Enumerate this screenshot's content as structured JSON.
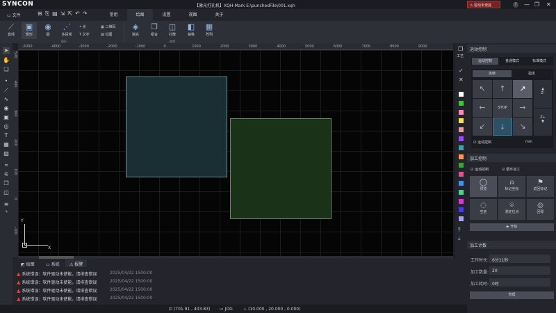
{
  "app": {
    "logo": "SYNCON",
    "title": "【激光打孔机】XQH-Mark  E:\\punchedFile\\001.xqh",
    "alarm": "驱动未使能",
    "help": "?",
    "minimize": "—",
    "restore": "❐",
    "close": "✕"
  },
  "menu": {
    "file": "文件",
    "tabs": [
      {
        "label": "常用"
      },
      {
        "label": "绘图"
      },
      {
        "label": "设置"
      },
      {
        "label": "视图"
      },
      {
        "label": "关于"
      }
    ],
    "active": "绘图"
  },
  "ribbon": {
    "draw": [
      {
        "label": "直线",
        "icon": "line-icon"
      },
      {
        "label": "矩形",
        "icon": "rectangle-icon"
      },
      {
        "label": "圆",
        "icon": "circle-icon"
      },
      {
        "label": "多段线",
        "icon": "polyline-icon"
      }
    ],
    "small": [
      {
        "label": "点"
      },
      {
        "label": "文字"
      },
      {
        "label": "二维码"
      },
      {
        "label": "位图"
      }
    ],
    "group1": "图形",
    "edit": [
      {
        "label": "填充"
      },
      {
        "label": "组合"
      },
      {
        "label": "打散"
      },
      {
        "label": "镜像"
      },
      {
        "label": "阵列"
      }
    ],
    "group2": "编辑"
  },
  "ruler": {
    "x": [
      "-5000",
      "-4000",
      "-3000",
      "-2000",
      "-1000",
      "0",
      "1000",
      "2000",
      "3000",
      "4000",
      "5000",
      "6000",
      "7000",
      "8000",
      "9000"
    ],
    "y": [
      "500",
      "400",
      "300",
      "200",
      "100",
      "0",
      "-100"
    ]
  },
  "canvas": {
    "axis_x": "X",
    "axis_y": "Y",
    "shapes": [
      {
        "fill": "#1a2f33",
        "stroke": "#6e8a8c"
      },
      {
        "fill": "#1a3318",
        "stroke": "#6a8268"
      }
    ]
  },
  "bottom": {
    "tabs": [
      {
        "label": "绘图"
      },
      {
        "label": "系统"
      },
      {
        "label": "报警"
      }
    ],
    "messages": [
      {
        "text": "系统错误：软件驱动未使能，请排查错误",
        "time": "2025/04/22 1500:00"
      },
      {
        "text": "系统错误：软件驱动未使能，请排查错误",
        "time": "2025/04/22 1500:00"
      },
      {
        "text": "系统错误：软件驱动未使能，请排查错误",
        "time": "2025/04/22 1500:00"
      },
      {
        "text": "系统错误：软件驱动未使能，请排查错误",
        "time": "2025/04/22 1500:00"
      }
    ]
  },
  "status": {
    "cursor": "(701.91 , 403.83)",
    "mode": "JOG",
    "position": "(10.000 , 20.000 , 0.000)"
  },
  "strip": {
    "craft": "工艺",
    "colors": [
      "#ffffff",
      "#33cc33",
      "#f28cb8",
      "#f0e060",
      "#f29a9a",
      "#9a4cf0",
      "#3aa8a0",
      "#f09a60",
      "#3aa040",
      "#e8508a",
      "#4a90e0",
      "#40d890",
      "#d040d0",
      "#4040e0",
      "#a8a0f0"
    ]
  },
  "motion": {
    "title": "运动控制",
    "tabs": [
      "运动控制",
      "普通模式",
      "标准模式"
    ],
    "subtabs": [
      "连续",
      "指定"
    ],
    "stop": "STOP",
    "zminus": "Z-",
    "zplus": "Z+",
    "check": "运动控制",
    "unit": "mm"
  },
  "process": {
    "title": "加工控制",
    "checks": [
      "运动控制",
      "循环加工"
    ],
    "buttons": [
      {
        "label": "预览",
        "icon": "eye-icon"
      },
      {
        "label": "标记坐标",
        "icon": "location-icon"
      },
      {
        "label": "返回标记",
        "icon": "return-flag-icon"
      },
      {
        "label": "空走",
        "icon": "dry-run-icon"
      },
      {
        "label": "测定位点",
        "icon": "pin-icon"
      },
      {
        "label": "回零",
        "icon": "home-icon"
      }
    ],
    "start": "▶ 开始"
  },
  "count": {
    "title": "加工计数",
    "fields": [
      {
        "label": "工作时长:",
        "value": "6分11秒"
      },
      {
        "label": "加工数量:",
        "value": "20"
      },
      {
        "label": "加工耗时:",
        "value": "0时"
      }
    ],
    "manage": "管理"
  }
}
